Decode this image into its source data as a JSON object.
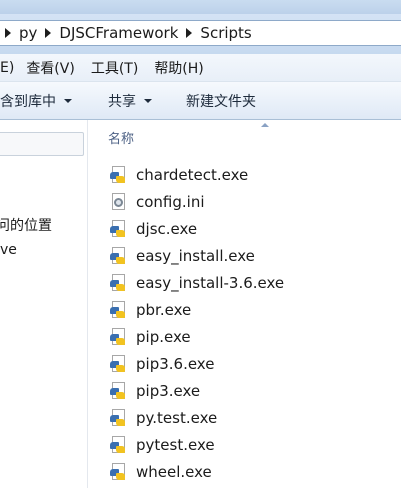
{
  "breadcrumb": {
    "items": [
      "py",
      "DJSCFramework",
      "Scripts"
    ]
  },
  "menu": {
    "items": [
      "E)",
      "查看(V)",
      "工具(T)",
      "帮助(H)"
    ]
  },
  "toolbar": {
    "include_in_library": "包含到库中",
    "share": "共享",
    "new_folder": "新建文件夹"
  },
  "nav": {
    "recent_places": "问的位置",
    "drive_fragment": "ve"
  },
  "file_list": {
    "column_name": "名称",
    "files": [
      {
        "name": "chardetect.exe",
        "icon": "python-exe-icon"
      },
      {
        "name": "config.ini",
        "icon": "config-file-icon"
      },
      {
        "name": "djsc.exe",
        "icon": "python-exe-icon"
      },
      {
        "name": "easy_install.exe",
        "icon": "python-exe-icon"
      },
      {
        "name": "easy_install-3.6.exe",
        "icon": "python-exe-icon"
      },
      {
        "name": "pbr.exe",
        "icon": "python-exe-icon"
      },
      {
        "name": "pip.exe",
        "icon": "python-exe-icon"
      },
      {
        "name": "pip3.6.exe",
        "icon": "python-exe-icon"
      },
      {
        "name": "pip3.exe",
        "icon": "python-exe-icon"
      },
      {
        "name": "py.test.exe",
        "icon": "python-exe-icon"
      },
      {
        "name": "pytest.exe",
        "icon": "python-exe-icon"
      },
      {
        "name": "wheel.exe",
        "icon": "python-exe-icon"
      }
    ]
  }
}
